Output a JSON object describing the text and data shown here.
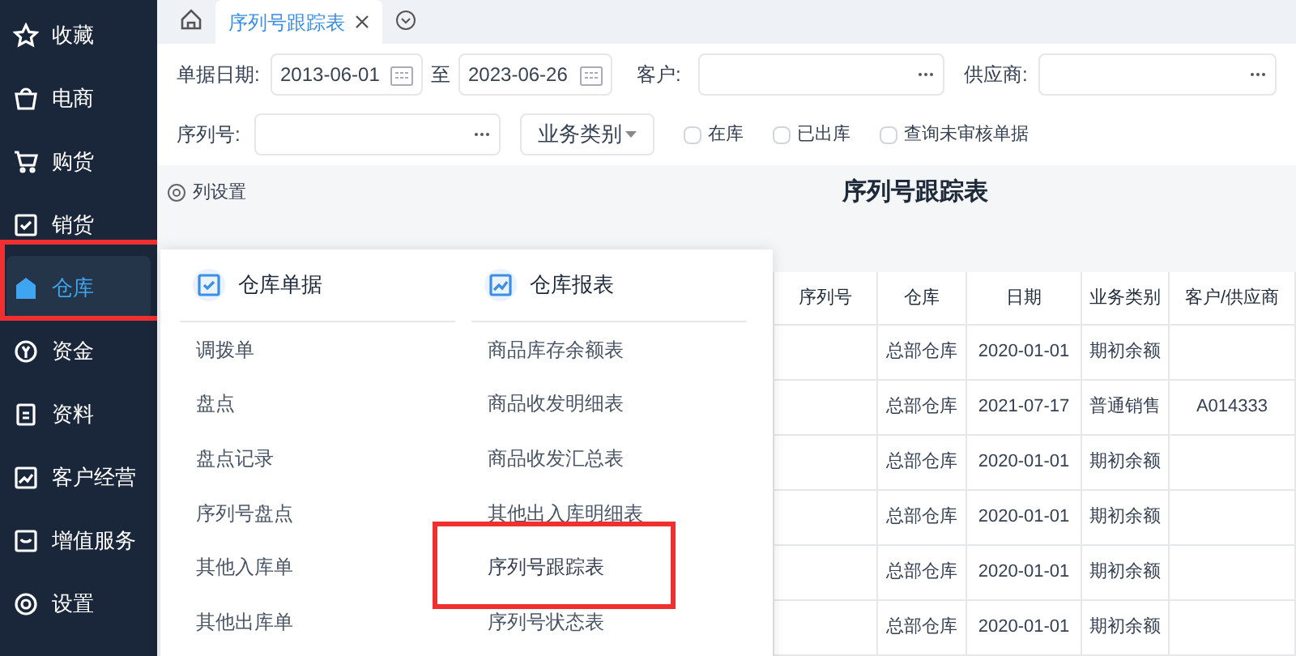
{
  "sidebar": {
    "items": [
      {
        "label": "收藏",
        "kind": "star",
        "selected": false
      },
      {
        "label": "电商",
        "kind": "basket",
        "selected": false
      },
      {
        "label": "购货",
        "kind": "cart",
        "selected": false
      },
      {
        "label": "销货",
        "kind": "doc",
        "selected": false
      },
      {
        "label": "仓库",
        "kind": "house",
        "selected": true
      },
      {
        "label": "资金",
        "kind": "coin",
        "selected": false
      },
      {
        "label": "资料",
        "kind": "file",
        "selected": false
      },
      {
        "label": "客户经营",
        "kind": "chart",
        "selected": false
      },
      {
        "label": "增值服务",
        "kind": "box",
        "selected": false
      },
      {
        "label": "设置",
        "kind": "gear",
        "selected": false
      }
    ]
  },
  "tabs": [
    {
      "label": "序列号跟踪表",
      "selected": true
    }
  ],
  "filters": {
    "date_label": "单据日期:",
    "date_from": "2013-06-01",
    "to": "至",
    "date_to": "2023-06-26",
    "customer_label": "客户:",
    "supplier_label": "供应商:",
    "serial_label": "序列号:",
    "business_type": "业务类别",
    "checkboxes": [
      {
        "label": "在库",
        "checked": false
      },
      {
        "label": "已出库",
        "checked": false
      },
      {
        "label": "查询未审核单据",
        "checked": false
      }
    ]
  },
  "column_settings": "列设置",
  "report_title": "序列号跟踪表",
  "table": {
    "columns": [
      "序列号",
      "仓库",
      "日期",
      "业务类别",
      "客户/供应商"
    ],
    "rows": [
      [
        "",
        "总部仓库",
        "2020-01-01",
        "期初余额",
        ""
      ],
      [
        "",
        "总部仓库",
        "2021-07-17",
        "普通销售",
        "A014333"
      ],
      [
        "",
        "总部仓库",
        "2020-01-01",
        "期初余额",
        ""
      ],
      [
        "",
        "总部仓库",
        "2020-01-01",
        "期初余额",
        ""
      ],
      [
        "",
        "总部仓库",
        "2020-01-01",
        "期初余额",
        ""
      ],
      [
        "",
        "总部仓库",
        "2020-01-01",
        "期初余额",
        ""
      ]
    ]
  },
  "menu": {
    "columns": [
      {
        "title": "仓库单据",
        "kind": "doc",
        "items": [
          {
            "label": "调拨单",
            "highlighted": false
          },
          {
            "label": "盘点",
            "highlighted": false
          },
          {
            "label": "盘点记录",
            "highlighted": false
          },
          {
            "label": "序列号盘点",
            "highlighted": false
          },
          {
            "label": "其他入库单",
            "highlighted": false
          },
          {
            "label": "其他出库单",
            "highlighted": false
          }
        ]
      },
      {
        "title": "仓库报表",
        "kind": "chart",
        "items": [
          {
            "label": "商品库存余额表",
            "highlighted": false
          },
          {
            "label": "商品收发明细表",
            "highlighted": false
          },
          {
            "label": "商品收发汇总表",
            "highlighted": false
          },
          {
            "label": "其他出入库明细表",
            "highlighted": false
          },
          {
            "label": "序列号跟踪表",
            "highlighted": true
          },
          {
            "label": "序列号状态表",
            "highlighted": false
          }
        ]
      }
    ]
  }
}
